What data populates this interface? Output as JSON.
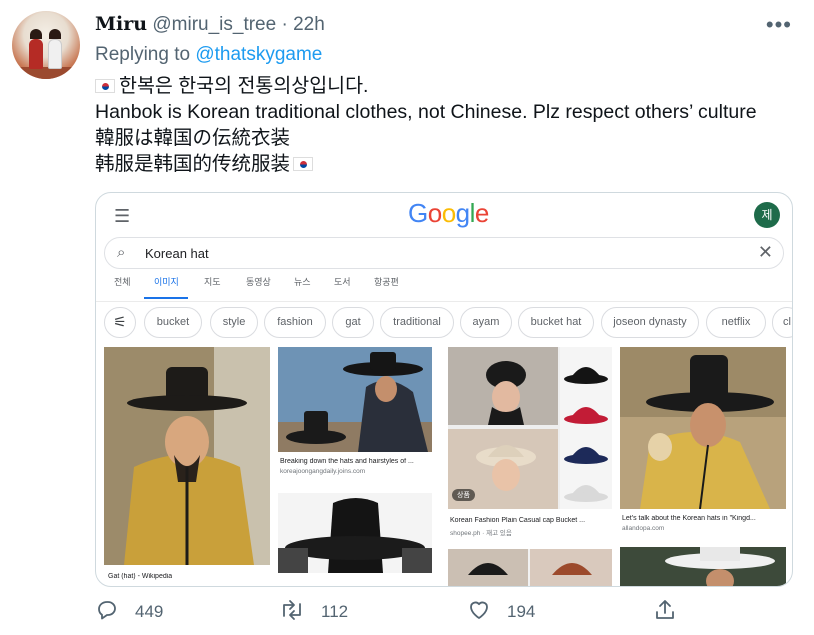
{
  "tweet": {
    "display_name": "Miru",
    "handle": "@miru_is_tree",
    "separator": "·",
    "time": "22h",
    "more_icon": "more-horizontal-icon",
    "replying_label": "Replying to",
    "replying_to": "@thatskygame",
    "lines": [
      "한복은 한국의 전통의상입니다.",
      "Hanbok is Korean traditional clothes, not Chinese. Plz respect others’ culture",
      "韓服は韓国の伝統衣装",
      "韩服是韩国的传统服装"
    ],
    "flag_icon": "south-korea-flag-icon"
  },
  "google_screenshot": {
    "logo": [
      "G",
      "o",
      "o",
      "g",
      "l",
      "e"
    ],
    "account_initial": "제",
    "search_value": "Korean hat",
    "tabs": [
      "전체",
      "이미지",
      "지도",
      "동영상",
      "뉴스",
      "도서",
      "항공편"
    ],
    "active_tab": "이미지",
    "chips": [
      "bucket",
      "style",
      "fashion",
      "gat",
      "traditional",
      "ayam",
      "bucket hat",
      "joseon dynasty",
      "netflix",
      "cl"
    ],
    "results": [
      {
        "caption": "Gat (hat) - Wikipedia",
        "source": ""
      },
      {
        "caption": "Breaking down the hats and hairstyles of ...",
        "source": "koreajoongangdaily.joins.com"
      },
      {
        "caption": "Korean Fashion Plain Casual cap Bucket ...",
        "source": "shopee.ph · 재고 있음",
        "badge": "상품"
      },
      {
        "caption": "Let's talk about the Korean hats in \"Kingd...",
        "source": "allandopa.com"
      }
    ]
  },
  "actions": {
    "reply_count": "449",
    "retweet_count": "112",
    "like_count": "194",
    "reply_icon": "reply-icon",
    "retweet_icon": "retweet-icon",
    "like_icon": "heart-icon",
    "share_icon": "share-icon"
  },
  "colors": {
    "accent": "#1d9bf0",
    "text": "#0f1419",
    "muted": "#536471"
  }
}
